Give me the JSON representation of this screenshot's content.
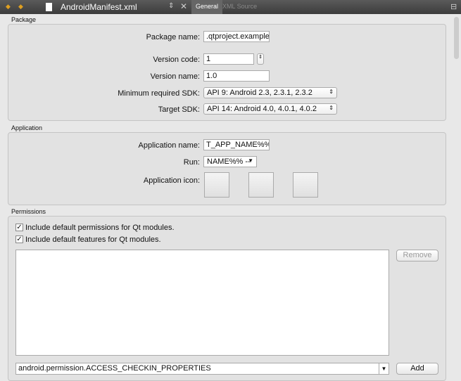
{
  "toolbar": {
    "file": "AndroidManifest.xml",
    "tabs": [
      "General",
      "XML Source"
    ]
  },
  "package": {
    "section": "Package",
    "package_name_label": "Package name:",
    "package_name": ".qtproject.example",
    "version_code_label": "Version code:",
    "version_code": "1",
    "version_name_label": "Version name:",
    "version_name": "1.0",
    "min_sdk_label": "Minimum required SDK:",
    "min_sdk": "API 9: Android 2.3, 2.3.1, 2.3.2",
    "target_sdk_label": "Target SDK:",
    "target_sdk": "API 14: Android 4.0, 4.0.1, 4.0.2"
  },
  "application": {
    "section": "Application",
    "app_name_label": "Application name:",
    "app_name": "T_APP_NAME%% --",
    "run_label": "Run:",
    "run": "NAME%% --",
    "icon_label": "Application icon:"
  },
  "permissions": {
    "section": "Permissions",
    "default_permissions": "Include default permissions for Qt modules.",
    "default_features": "Include default features for Qt modules.",
    "remove": "Remove",
    "add": "Add",
    "permission_value": "android.permission.ACCESS_CHECKIN_PROPERTIES"
  }
}
